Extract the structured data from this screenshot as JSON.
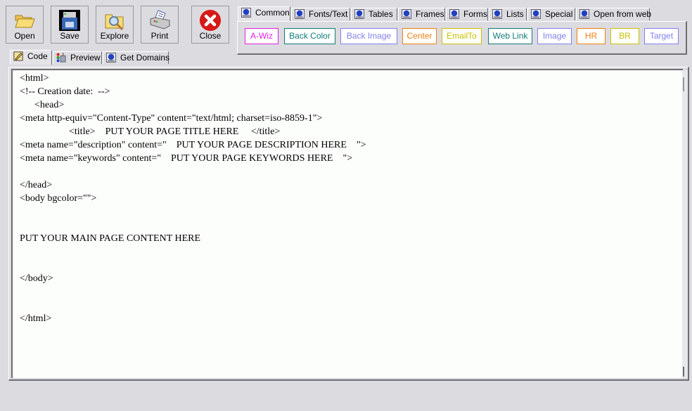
{
  "toolbar": {
    "buttons": [
      {
        "label": "Open",
        "icon": "folder-open-icon"
      },
      {
        "label": "Save",
        "icon": "floppy-disk-icon"
      },
      {
        "label": "Explore",
        "icon": "folder-search-icon"
      },
      {
        "label": "Print",
        "icon": "printer-icon"
      },
      {
        "label": "Close",
        "icon": "close-x-icon"
      }
    ]
  },
  "view_tabs": [
    {
      "label": "Code",
      "icon": "pencil-note-icon",
      "active": true
    },
    {
      "label": "Preview",
      "icon": "preview-paint-icon",
      "active": false
    },
    {
      "label": "Get Domains",
      "icon": "html-globe-icon",
      "active": false
    }
  ],
  "tag_tabs": [
    {
      "label": "Common",
      "active": true
    },
    {
      "label": "Fonts/Text",
      "active": false
    },
    {
      "label": "Tables",
      "active": false
    },
    {
      "label": "Frames",
      "active": false
    },
    {
      "label": "Forms",
      "active": false
    },
    {
      "label": "Lists",
      "active": false
    },
    {
      "label": "Special",
      "active": false
    },
    {
      "label": "Open from web",
      "active": false
    }
  ],
  "common_buttons": [
    {
      "label": "A-Wiz",
      "color": "#e020e0"
    },
    {
      "label": "Back Color",
      "color": "#107c78"
    },
    {
      "label": "Back Image",
      "color": "#8080f0"
    },
    {
      "label": "Center",
      "color": "#f08010"
    },
    {
      "label": "EmailTo",
      "color": "#c8c000"
    },
    {
      "label": "Web Link",
      "color": "#107c78"
    },
    {
      "label": "Image",
      "color": "#8080f0"
    },
    {
      "label": "HR",
      "color": "#f08010"
    },
    {
      "label": "BR",
      "color": "#c8c000"
    },
    {
      "label": "Target",
      "color": "#8080f0"
    }
  ],
  "editor": {
    "lines": [
      "<html>",
      "<!-- Creation date:  -->",
      "      <head>",
      "<meta http-equiv=\"Content-Type\" content=\"text/html; charset=iso-8859-1\">",
      "                    <title>    PUT YOUR PAGE TITLE HERE     </title>",
      "<meta name=\"description\" content=\"    PUT YOUR PAGE DESCRIPTION HERE    \">",
      "<meta name=\"keywords\" content=\"    PUT YOUR PAGE KEYWORDS HERE    \">",
      "",
      "</head>",
      "<body bgcolor=\"\">",
      "",
      "",
      "PUT YOUR MAIN PAGE CONTENT HERE",
      "",
      "",
      "</body>",
      "",
      "",
      "</html>"
    ]
  }
}
